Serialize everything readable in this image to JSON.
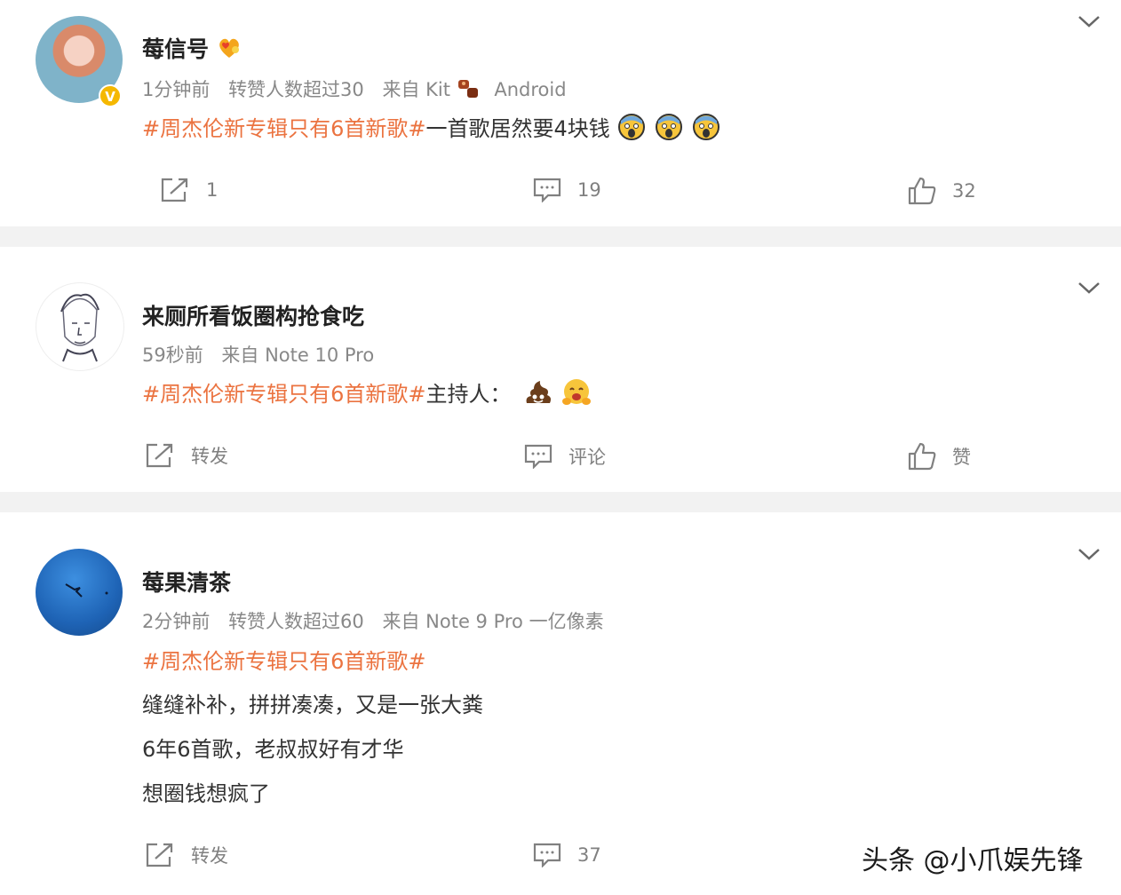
{
  "posts": [
    {
      "username": "莓信号",
      "time": "1分钟前",
      "stat": "转赞人数超过30",
      "source_prefix": "来自 Kit",
      "source_suffix": "Android",
      "hashtag": "#周杰伦新专辑只有6首新歌#",
      "text": "一首歌居然要4块钱",
      "verified_badge": "V",
      "repost_count": "1",
      "comment_count": "19",
      "like_count": "32"
    },
    {
      "username": "来厕所看饭圈构抢食吃",
      "time": "59秒前",
      "source": "来自 Note 10 Pro",
      "hashtag": "#周杰伦新专辑只有6首新歌#",
      "text": "主持人：",
      "repost_label": "转发",
      "comment_label": "评论",
      "like_label": "赞"
    },
    {
      "username": "莓果清茶",
      "time": "2分钟前",
      "stat": "转赞人数超过60",
      "source": "来自 Note 9 Pro 一亿像素",
      "hashtag": "#周杰伦新专辑只有6首新歌#",
      "lines": [
        "缝缝补补，拼拼凑凑，又是一张大粪",
        "6年6首歌，老叔叔好有才华",
        "想圈钱想疯了"
      ],
      "repost_label": "转发",
      "comment_count": "37"
    }
  ],
  "watermark": "头条 @小爪娱先锋",
  "colors": {
    "hashtag": "#eb7340",
    "meta": "#888888",
    "action": "#808080",
    "badge": "#f5b800"
  }
}
